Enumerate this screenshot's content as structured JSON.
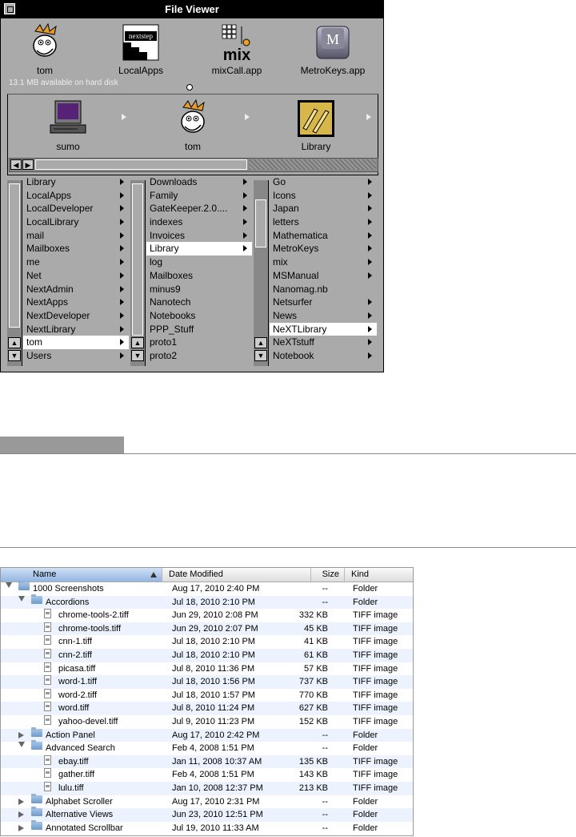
{
  "file_viewer": {
    "title": "File Viewer",
    "shelf": [
      {
        "label": "tom",
        "icon": "calvin-face-icon"
      },
      {
        "label": "LocalApps",
        "icon": "nextstep-folder-icon",
        "badge": "nextstep"
      },
      {
        "label": "mixCall.app",
        "icon": "mix-app-icon",
        "badge": "mix"
      },
      {
        "label": "MetroKeys.app",
        "icon": "key-cap-icon",
        "badge": "M"
      }
    ],
    "disk_info": "13.1 MB available on hard disk",
    "path": [
      {
        "label": "sumo",
        "icon": "computer-icon"
      },
      {
        "label": "tom",
        "icon": "calvin-face-icon"
      },
      {
        "label": "Library",
        "icon": "library-books-icon"
      }
    ],
    "columns": [
      {
        "items": [
          "Library",
          "LocalApps",
          "LocalDeveloper",
          "LocalLibrary",
          "mail",
          "Mailboxes",
          "me",
          "Net",
          "NextAdmin",
          "NextApps",
          "NextDeveloper",
          "NextLibrary",
          "tom",
          "Users"
        ],
        "selected": 12
      },
      {
        "items": [
          "Downloads",
          "Family",
          "GateKeeper.2.0....",
          "indexes",
          "Invoices",
          "Library",
          "log",
          "Mailboxes",
          "minus9",
          "Nanotech",
          "Notebooks",
          "PPP_Stuff",
          "proto1",
          "proto2"
        ],
        "selected": 5
      },
      {
        "items": [
          "Go",
          "Icons",
          "Japan",
          "letters",
          "Mathematica",
          "MetroKeys",
          "mix",
          "MSManual",
          "Nanomag.nb",
          "Netsurfer",
          "News",
          "NeXTLibrary",
          "NeXTstuff",
          "Notebook"
        ],
        "selected": 11
      }
    ],
    "leaf_items": [
      [
        "log",
        "Mailboxes",
        "minus9",
        "Nanotech",
        "Notebooks",
        "PPP_Stuff",
        "proto1",
        "proto2"
      ],
      [
        "Nanomag.nb"
      ]
    ]
  },
  "finder": {
    "headers": {
      "name": "Name",
      "date": "Date Modified",
      "size": "Size",
      "kind": "Kind"
    },
    "rows": [
      {
        "level": 0,
        "disc": "open",
        "type": "folder",
        "name": "1000 Screenshots",
        "date": "Aug 17, 2010 2:40 PM",
        "size": "--",
        "kind": "Folder"
      },
      {
        "level": 1,
        "disc": "open",
        "type": "folder",
        "name": "Accordions",
        "date": "Jul 18, 2010 2:10 PM",
        "size": "--",
        "kind": "Folder"
      },
      {
        "level": 2,
        "disc": "",
        "type": "file",
        "name": "chrome-tools-2.tiff",
        "date": "Jun 29, 2010 2:08 PM",
        "size": "332 KB",
        "kind": "TIFF image"
      },
      {
        "level": 2,
        "disc": "",
        "type": "file",
        "name": "chrome-tools.tiff",
        "date": "Jun 29, 2010 2:07 PM",
        "size": "45 KB",
        "kind": "TIFF image"
      },
      {
        "level": 2,
        "disc": "",
        "type": "file",
        "name": "cnn-1.tiff",
        "date": "Jul 18, 2010 2:10 PM",
        "size": "41 KB",
        "kind": "TIFF image"
      },
      {
        "level": 2,
        "disc": "",
        "type": "file",
        "name": "cnn-2.tiff",
        "date": "Jul 18, 2010 2:10 PM",
        "size": "61 KB",
        "kind": "TIFF image"
      },
      {
        "level": 2,
        "disc": "",
        "type": "file",
        "name": "picasa.tiff",
        "date": "Jul 8, 2010 11:36 PM",
        "size": "57 KB",
        "kind": "TIFF image"
      },
      {
        "level": 2,
        "disc": "",
        "type": "file",
        "name": "word-1.tiff",
        "date": "Jul 18, 2010 1:56 PM",
        "size": "737 KB",
        "kind": "TIFF image"
      },
      {
        "level": 2,
        "disc": "",
        "type": "file",
        "name": "word-2.tiff",
        "date": "Jul 18, 2010 1:57 PM",
        "size": "770 KB",
        "kind": "TIFF image"
      },
      {
        "level": 2,
        "disc": "",
        "type": "file",
        "name": "word.tiff",
        "date": "Jul 8, 2010 11:24 PM",
        "size": "627 KB",
        "kind": "TIFF image"
      },
      {
        "level": 2,
        "disc": "",
        "type": "file",
        "name": "yahoo-devel.tiff",
        "date": "Jul 9, 2010 11:23 PM",
        "size": "152 KB",
        "kind": "TIFF image"
      },
      {
        "level": 1,
        "disc": "closed",
        "type": "folder",
        "name": "Action Panel",
        "date": "Aug 17, 2010 2:42 PM",
        "size": "--",
        "kind": "Folder"
      },
      {
        "level": 1,
        "disc": "open",
        "type": "folder",
        "name": "Advanced Search",
        "date": "Feb 4, 2008 1:51 PM",
        "size": "--",
        "kind": "Folder"
      },
      {
        "level": 2,
        "disc": "",
        "type": "file",
        "name": "ebay.tiff",
        "date": "Jan 11, 2008 10:37 AM",
        "size": "135 KB",
        "kind": "TIFF image"
      },
      {
        "level": 2,
        "disc": "",
        "type": "file",
        "name": "gather.tiff",
        "date": "Feb 4, 2008 1:51 PM",
        "size": "143 KB",
        "kind": "TIFF image"
      },
      {
        "level": 2,
        "disc": "",
        "type": "file",
        "name": "lulu.tiff",
        "date": "Jan 10, 2008 12:37 PM",
        "size": "213 KB",
        "kind": "TIFF image"
      },
      {
        "level": 1,
        "disc": "closed",
        "type": "folder",
        "name": "Alphabet Scroller",
        "date": "Aug 17, 2010 2:31 PM",
        "size": "--",
        "kind": "Folder"
      },
      {
        "level": 1,
        "disc": "closed",
        "type": "folder",
        "name": "Alternative Views",
        "date": "Jun 23, 2010 12:51 PM",
        "size": "--",
        "kind": "Folder"
      },
      {
        "level": 1,
        "disc": "closed",
        "type": "folder",
        "name": "Annotated Scrollbar",
        "date": "Jul 19, 2010 11:33 AM",
        "size": "--",
        "kind": "Folder"
      }
    ]
  }
}
